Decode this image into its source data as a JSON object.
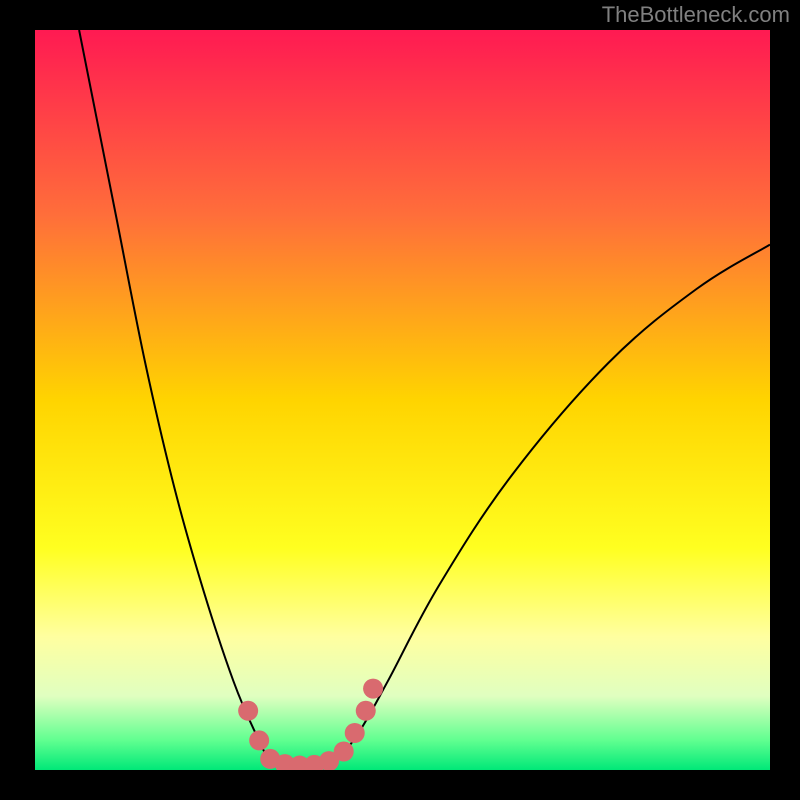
{
  "watermark": "TheBottleneck.com",
  "chart_data": {
    "type": "line",
    "title": "",
    "xlabel": "",
    "ylabel": "",
    "xlim": [
      0,
      100
    ],
    "ylim": [
      0,
      100
    ],
    "gradient_stops": [
      {
        "offset": 0,
        "color": "#ff1a52"
      },
      {
        "offset": 25,
        "color": "#ff6e3a"
      },
      {
        "offset": 50,
        "color": "#ffd400"
      },
      {
        "offset": 70,
        "color": "#ffff20"
      },
      {
        "offset": 82,
        "color": "#ffffa0"
      },
      {
        "offset": 90,
        "color": "#e0ffc0"
      },
      {
        "offset": 96,
        "color": "#60ff90"
      },
      {
        "offset": 100,
        "color": "#00e878"
      }
    ],
    "series": [
      {
        "name": "bottleneck-curve",
        "color": "#000000",
        "points": [
          {
            "x": 6,
            "y": 100
          },
          {
            "x": 8,
            "y": 90
          },
          {
            "x": 11,
            "y": 75
          },
          {
            "x": 15,
            "y": 55
          },
          {
            "x": 19,
            "y": 38
          },
          {
            "x": 23,
            "y": 24
          },
          {
            "x": 27,
            "y": 12
          },
          {
            "x": 30,
            "y": 5
          },
          {
            "x": 32,
            "y": 1.5
          },
          {
            "x": 35,
            "y": 0.5
          },
          {
            "x": 38,
            "y": 0.5
          },
          {
            "x": 41,
            "y": 1.5
          },
          {
            "x": 44,
            "y": 5
          },
          {
            "x": 48,
            "y": 12
          },
          {
            "x": 55,
            "y": 25
          },
          {
            "x": 65,
            "y": 40
          },
          {
            "x": 78,
            "y": 55
          },
          {
            "x": 90,
            "y": 65
          },
          {
            "x": 100,
            "y": 71
          }
        ]
      }
    ],
    "markers": [
      {
        "x": 29,
        "y": 8
      },
      {
        "x": 30.5,
        "y": 4
      },
      {
        "x": 32,
        "y": 1.5
      },
      {
        "x": 34,
        "y": 0.8
      },
      {
        "x": 36,
        "y": 0.6
      },
      {
        "x": 38,
        "y": 0.7
      },
      {
        "x": 40,
        "y": 1.2
      },
      {
        "x": 42,
        "y": 2.5
      },
      {
        "x": 43.5,
        "y": 5
      },
      {
        "x": 45,
        "y": 8
      },
      {
        "x": 46,
        "y": 11
      }
    ],
    "marker_color": "#d96a6f",
    "marker_radius": 10
  }
}
